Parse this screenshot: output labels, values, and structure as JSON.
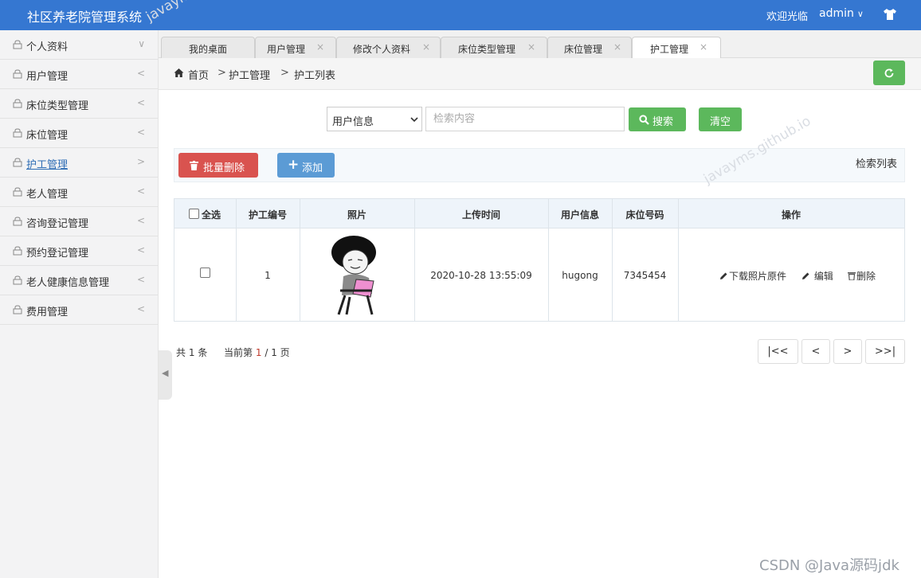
{
  "header": {
    "title": "社区养老院管理系统",
    "welcome": "欢迎光临",
    "user": "admin"
  },
  "sidebar": {
    "items": [
      {
        "label": "个人资料",
        "arrow": "∨"
      },
      {
        "label": "用户管理",
        "arrow": "<"
      },
      {
        "label": "床位类型管理",
        "arrow": "<"
      },
      {
        "label": "床位管理",
        "arrow": "<"
      },
      {
        "label": "护工管理",
        "arrow": ">"
      },
      {
        "label": "老人管理",
        "arrow": "<"
      },
      {
        "label": "咨询登记管理",
        "arrow": "<"
      },
      {
        "label": "预约登记管理",
        "arrow": "<"
      },
      {
        "label": "老人健康信息管理",
        "arrow": "<"
      },
      {
        "label": "费用管理",
        "arrow": "<"
      }
    ],
    "active_index": 4
  },
  "tabs": [
    {
      "label": "我的桌面"
    },
    {
      "label": "用户管理"
    },
    {
      "label": "修改个人资料"
    },
    {
      "label": "床位类型管理"
    },
    {
      "label": "床位管理"
    },
    {
      "label": "护工管理"
    }
  ],
  "breadcrumb": {
    "home": "首页",
    "sep": ">",
    "level1": "护工管理",
    "level2": "护工列表"
  },
  "search": {
    "field_selected": "用户信息",
    "placeholder": "检索内容",
    "search_label": "搜索",
    "clear_label": "清空"
  },
  "toolbar": {
    "batch_delete_label": "批量删除",
    "add_label": "添加",
    "list_title": "检索列表"
  },
  "table": {
    "headers": [
      "全选",
      "护工编号",
      "照片",
      "上传时间",
      "用户信息",
      "床位号码",
      "操作"
    ],
    "rows": [
      {
        "id": "1",
        "upload_time": "2020-10-28 13:55:09",
        "user": "hugong",
        "bed": "7345454",
        "ops": {
          "download": "下载照片原件",
          "edit": "编辑",
          "delete": "删除"
        }
      }
    ]
  },
  "pager": {
    "total_prefix": "共",
    "total": "1",
    "total_suffix": "条",
    "current_prefix": "当前第",
    "current": "1",
    "slash": "/",
    "pages": "1",
    "pages_suffix": "页",
    "first": "|<<",
    "prev": "<",
    "next": ">",
    "last": ">>|"
  },
  "watermarks": {
    "site": "javayms.github.io",
    "corner": "CSDN @Java源码jdk"
  },
  "colors": {
    "header": "#3577d1",
    "green": "#5cb85c",
    "red": "#d9534f",
    "blue": "#5b9bd5",
    "active_link": "#2e6db5"
  }
}
